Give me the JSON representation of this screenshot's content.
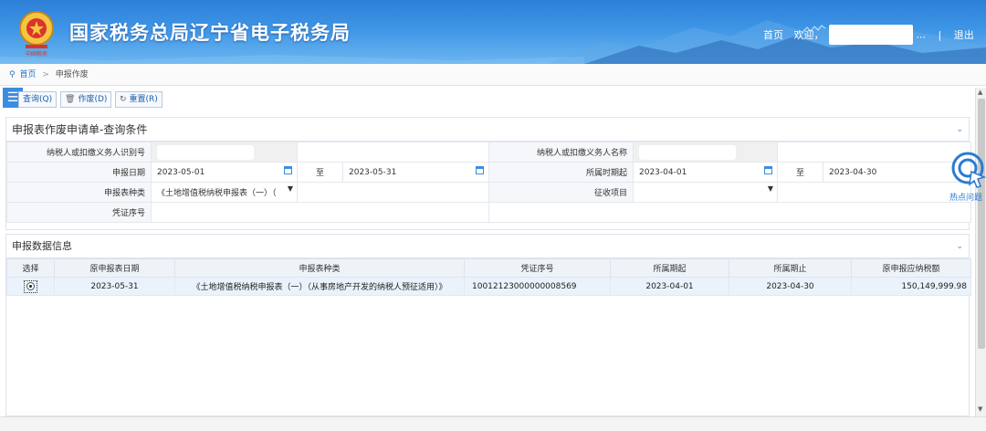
{
  "header": {
    "title": "国家税务总局辽宁省电子税务局",
    "home_link": "首页",
    "welcome": "欢迎，",
    "ellipsis": "...",
    "separator": "|",
    "logout": "退出"
  },
  "breadcrumb": {
    "home": "首页",
    "sep": ">",
    "current": "申报作废"
  },
  "toolbar": {
    "query": "查询(Q)",
    "void": "作废(D)",
    "reset": "重置(R)"
  },
  "query_panel": {
    "title": "申报表作废申请单-查询条件",
    "taxpayer_id_label": "纳税人或扣缴义务人识别号",
    "taxpayer_name_label": "纳税人或扣缴义务人名称",
    "filing_date_label": "申报日期",
    "filing_date_from": "2023-05-01",
    "to_label": "至",
    "filing_date_to": "2023-05-31",
    "period_start_label": "所属时期起",
    "period_from": "2023-04-01",
    "period_to": "2023-04-30",
    "form_type_label": "申报表种类",
    "form_type_value": "《土地增值税纳税申报表（一）（",
    "levy_item_label": "征收项目",
    "levy_item_value": "",
    "voucher_label": "凭证序号"
  },
  "data_panel": {
    "title": "申报数据信息",
    "columns": [
      "选择",
      "原申报表日期",
      "申报表种类",
      "凭证序号",
      "所属期起",
      "所属期止",
      "原申报应纳税额"
    ],
    "rows": [
      {
        "filing_date": "2023-05-31",
        "form_type": "《土地增值税纳税申报表（一）（从事房地产开发的纳税人预征适用）》",
        "voucher_no": "10012123000000008569",
        "period_from": "2023-04-01",
        "period_to": "2023-04-30",
        "tax_amount": "150,149,999.98"
      }
    ]
  },
  "hotspot": {
    "label": "热点问题"
  },
  "colors": {
    "header_blue": "#3e95e6",
    "link_blue": "#1e73c8",
    "row_highlight": "#eaf3fc"
  }
}
